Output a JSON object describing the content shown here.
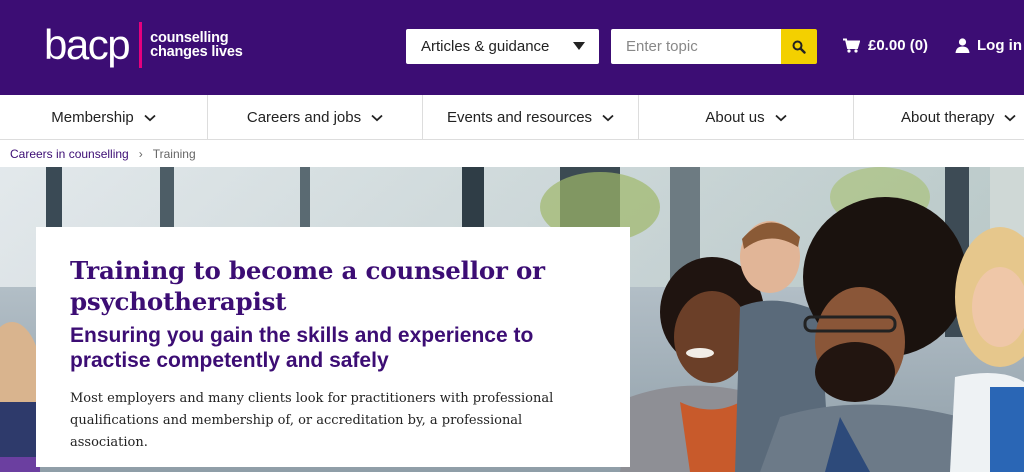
{
  "header": {
    "logo_text": "bacp",
    "tagline_line1": "counselling",
    "tagline_line2": "changes lives",
    "articles_label": "Articles & guidance",
    "search_placeholder": "Enter topic",
    "basket_label": "£0.00 (0)",
    "login_label": "Log in"
  },
  "nav": {
    "items": [
      {
        "label": "Membership"
      },
      {
        "label": "Careers and jobs"
      },
      {
        "label": "Events and resources"
      },
      {
        "label": "About us"
      },
      {
        "label": "About therapy"
      }
    ]
  },
  "breadcrumb": {
    "link": "Careers in counselling",
    "separator": "›",
    "current": "Training"
  },
  "hero": {
    "title": "Training to become a counsellor or psychotherapist",
    "subtitle": "Ensuring you gain the skills and experience to practise competently and safely",
    "body": "Most employers and many clients look for practitioners with professional qualifications and membership of, or accreditation by, a professional association."
  },
  "colors": {
    "brand_purple": "#3c0d74",
    "accent_pink": "#e6007e",
    "search_yellow": "#f3d000"
  },
  "icons": [
    "caret-down-icon",
    "search-icon",
    "basket-icon",
    "user-icon",
    "chevron-down-icon"
  ]
}
